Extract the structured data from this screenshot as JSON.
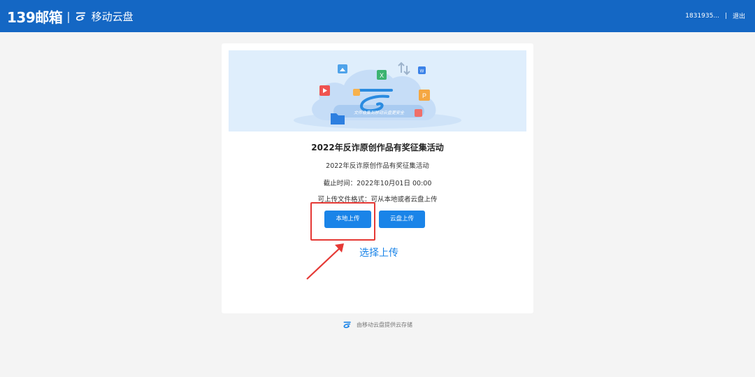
{
  "header": {
    "brand_139": "139邮箱",
    "separator": "|",
    "brand_pan": "移动云盘",
    "user": "1831935...",
    "user_sep": "|",
    "logout": "退出",
    "bg_color": "#1467c4"
  },
  "card": {
    "banner_text": "文件收集到移动云盘更安全",
    "title": "2022年反诈原创作品有奖征集活动",
    "subtitle": "2022年反诈原创作品有奖征集活动",
    "deadline": "截止时间：2022年10月01日 00:00",
    "formats": "可上传文件格式：可从本地或者云盘上传",
    "local_upload": "本地上传",
    "cloud_upload": "云盘上传",
    "annotation": "选择上传"
  },
  "footer": {
    "text": "由移动云盘提供云存储"
  },
  "icons": [
    "cloud-logo-icon",
    "image-file-icon",
    "excel-file-icon",
    "word-file-icon",
    "video-file-icon",
    "powerpoint-file-icon",
    "pdf-file-icon",
    "zip-file-icon",
    "folder-icon",
    "transfer-arrows-icon"
  ]
}
